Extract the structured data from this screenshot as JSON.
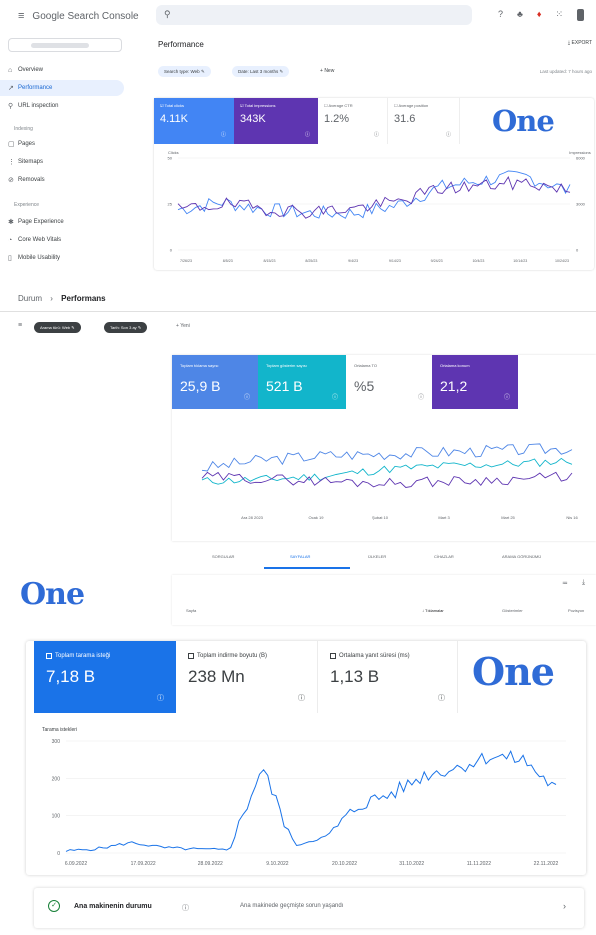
{
  "panel1": {
    "app_title": "Google Search Console",
    "nav_items": [
      {
        "label": "Overview",
        "icon": "home-icon"
      },
      {
        "label": "Performance",
        "icon": "trending-icon",
        "active": true
      },
      {
        "label": "URL inspection",
        "icon": "search-icon"
      }
    ],
    "section_indexing": "Indexing",
    "indexing_items": [
      {
        "label": "Pages",
        "icon": "pages-icon"
      },
      {
        "label": "Sitemaps",
        "icon": "sitemap-icon"
      },
      {
        "label": "Removals",
        "icon": "removals-icon"
      }
    ],
    "section_experience": "Experience",
    "experience_items": [
      {
        "label": "Page Experience",
        "icon": "page-experience-icon"
      },
      {
        "label": "Core Web Vitals",
        "icon": "vitals-icon"
      },
      {
        "label": "Mobile Usability",
        "icon": "mobile-icon"
      }
    ],
    "page_title": "Performance",
    "export_label": "EXPORT",
    "filters": [
      "Search type: Web",
      "Date: Last 3 months"
    ],
    "new_label": "New",
    "last_updated": "Last updated: 7 hours ago",
    "metrics": [
      {
        "label": "Total clicks",
        "value": "4.11K"
      },
      {
        "label": "Total impressions",
        "value": "343K"
      },
      {
        "label": "Average CTR",
        "value": "1.2%"
      },
      {
        "label": "Average position",
        "value": "31.6"
      }
    ],
    "logo": "One",
    "left_axis_title": "Clicks",
    "right_axis_title": "Impressions"
  },
  "panel2": {
    "breadcrumb_root": "Durum",
    "breadcrumb_sep": "›",
    "breadcrumb_current": "Performans",
    "filters": [
      "Arama türü: Web",
      "Tarih: Son 3 ay"
    ],
    "new_label": "Yeni",
    "metrics": [
      {
        "label": "Toplam tıklama sayısı",
        "value": "25,9 B"
      },
      {
        "label": "Toplam gösterim sayısı",
        "value": "521 B"
      },
      {
        "label": "Ortalama TO",
        "value": "%5"
      },
      {
        "label": "Ortalama konum",
        "value": "21,2"
      }
    ],
    "date_ticks": [
      "Ara 28 2023",
      "Ocak 19",
      "Şubat 10",
      "Mart 3",
      "Mart 25",
      "Nis 16"
    ],
    "tabs": [
      "SORGULAR",
      "SAYFALAR",
      "ÜLKELER",
      "CİHAZLAR",
      "ARAMA GÖRÜNÜMÜ"
    ],
    "active_tab": 1,
    "table_headers": [
      "Sayfa",
      "↓ Tıklamalar",
      "Gösterimler",
      "Pozisyon"
    ],
    "logo": "One"
  },
  "panel3": {
    "metrics": [
      {
        "label": "Toplam tarama isteği",
        "value": "7,18 B",
        "checked": true
      },
      {
        "label": "Toplam indirme boyutu (B)",
        "value": "238 Mn",
        "checked": false
      },
      {
        "label": "Ortalama yanıt süresi (ms)",
        "value": "1,13 B",
        "checked": false
      }
    ],
    "logo": "One",
    "chart_label": "Tarama istekleri",
    "status_title": "Ana makinenin durumu",
    "status_text": "Ana makinede geçmişte sorun yaşandı",
    "chevron": "›"
  },
  "colors": {
    "blue": "#4285f4",
    "purple": "#5e35b1",
    "teal": "#12b5cb",
    "logo_blue": "#2f6bd6",
    "primary_blue": "#1a73e8",
    "green": "#188038"
  },
  "chart_data": [
    {
      "type": "line",
      "x": [
        "7/26/23",
        "8/5/23",
        "8/15/23",
        "8/25/23",
        "9/4/23",
        "9/14/23",
        "9/24/23",
        "10/4/23",
        "10/14/23",
        "10/24/23"
      ],
      "y_left_ticks": [
        0,
        25,
        50
      ],
      "y_right_ticks": [
        0,
        3000,
        6000
      ],
      "series": [
        {
          "name": "Total clicks",
          "color": "#4285f4",
          "values": [
            22,
            26,
            22,
            20,
            20,
            24,
            34,
            38,
            40,
            32
          ]
        },
        {
          "name": "Total impressions",
          "color": "#5e35b1",
          "values": [
            2600,
            3000,
            2700,
            2500,
            2700,
            3100,
            4000,
            4200,
            4400,
            3900
          ]
        }
      ]
    },
    {
      "type": "line",
      "x": [
        "Ara 28 2023",
        "Ocak 19",
        "Şubat 10",
        "Mart 3",
        "Mart 25",
        "Nis 16"
      ],
      "series": [
        {
          "name": "Toplam tıklama sayısı",
          "color": "#4e86e6",
          "values": [
            45,
            55,
            60,
            62,
            64,
            66,
            68
          ]
        },
        {
          "name": "Toplam gösterim sayısı",
          "color": "#12b5cb",
          "values": [
            30,
            32,
            36,
            44,
            48,
            50,
            54
          ]
        },
        {
          "name": "Ortalama konum",
          "color": "#5e35b1",
          "values": [
            35,
            33,
            30,
            28,
            30,
            32,
            36
          ]
        }
      ]
    },
    {
      "type": "line",
      "title": "Tarama istekleri",
      "x": [
        "6.09.2022",
        "17.09.2022",
        "28.09.2022",
        "9.10.2022",
        "20.10.2022",
        "31.10.2022",
        "11.11.2022",
        "22.11.2022"
      ],
      "ylim": [
        0,
        300
      ],
      "y_ticks": [
        0,
        100,
        200,
        300
      ],
      "series": [
        {
          "name": "Toplam tarama isteği",
          "color": "#1a73e8",
          "values": [
            5,
            12,
            28,
            14,
            10,
            8,
            230,
            20,
            45,
            130,
            160,
            210,
            230,
            260,
            250,
            170
          ]
        }
      ]
    }
  ]
}
